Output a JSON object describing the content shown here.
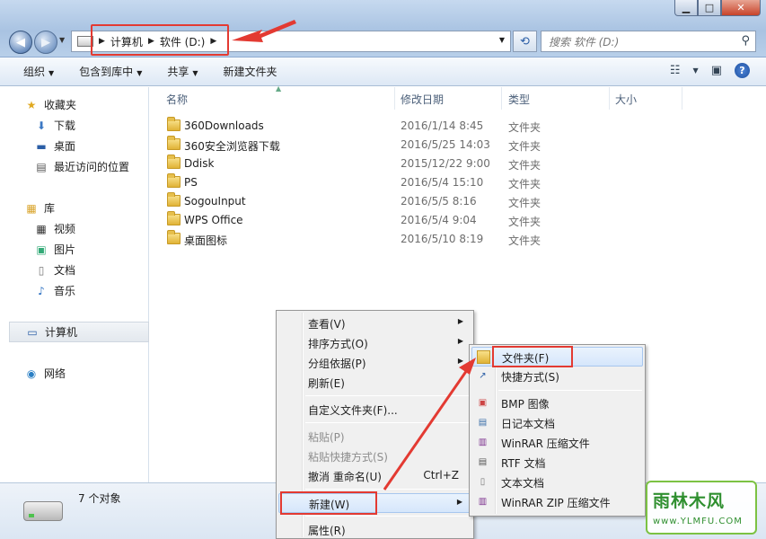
{
  "address": {
    "crumbs": [
      "计算机",
      "软件 (D:)"
    ],
    "search_placeholder": "搜索 软件 (D:)"
  },
  "commandbar": {
    "organize": "组织",
    "include_library": "包含到库中",
    "share": "共享",
    "new_folder": "新建文件夹"
  },
  "nav": {
    "favorites": "收藏夹",
    "downloads": "下载",
    "desktop": "桌面",
    "recent": "最近访问的位置",
    "libraries": "库",
    "videos": "视频",
    "pictures": "图片",
    "documents": "文档",
    "music": "音乐",
    "computer": "计算机",
    "network": "网络"
  },
  "columns": {
    "name": "名称",
    "date": "修改日期",
    "type": "类型",
    "size": "大小"
  },
  "files": [
    {
      "name": "360Downloads",
      "date": "2016/1/14 8:45",
      "type": "文件夹"
    },
    {
      "name": "360安全浏览器下载",
      "date": "2016/5/25 14:03",
      "type": "文件夹"
    },
    {
      "name": "Ddisk",
      "date": "2015/12/22 9:00",
      "type": "文件夹"
    },
    {
      "name": "PS",
      "date": "2016/5/4 15:10",
      "type": "文件夹"
    },
    {
      "name": "SogouInput",
      "date": "2016/5/5 8:16",
      "type": "文件夹"
    },
    {
      "name": "WPS Office",
      "date": "2016/5/4 9:04",
      "type": "文件夹"
    },
    {
      "name": "桌面图标",
      "date": "2016/5/10 8:19",
      "type": "文件夹"
    }
  ],
  "status": {
    "count": "7 个对象"
  },
  "context_menu": {
    "view": "查看(V)",
    "sort": "排序方式(O)",
    "group": "分组依据(P)",
    "refresh": "刷新(E)",
    "customize": "自定义文件夹(F)...",
    "paste": "粘贴(P)",
    "paste_shortcut": "粘贴快捷方式(S)",
    "undo": "撤消 重命名(U)",
    "undo_shortcut": "Ctrl+Z",
    "new": "新建(W)",
    "properties": "属性(R)"
  },
  "submenu": {
    "folder": "文件夹(F)",
    "shortcut": "快捷方式(S)",
    "bmp": "BMP 图像",
    "notepad": "日记本文档",
    "winrar": "WinRAR 压缩文件",
    "rtf": "RTF 文档",
    "text": "文本文档",
    "winrar_zip": "WinRAR ZIP 压缩文件"
  },
  "watermark": {
    "title": "雨林木风",
    "url": "www.YLMFU.COM"
  },
  "colors": {
    "highlight_red": "#e33a32",
    "menu_hover": "#d5e6fb"
  }
}
